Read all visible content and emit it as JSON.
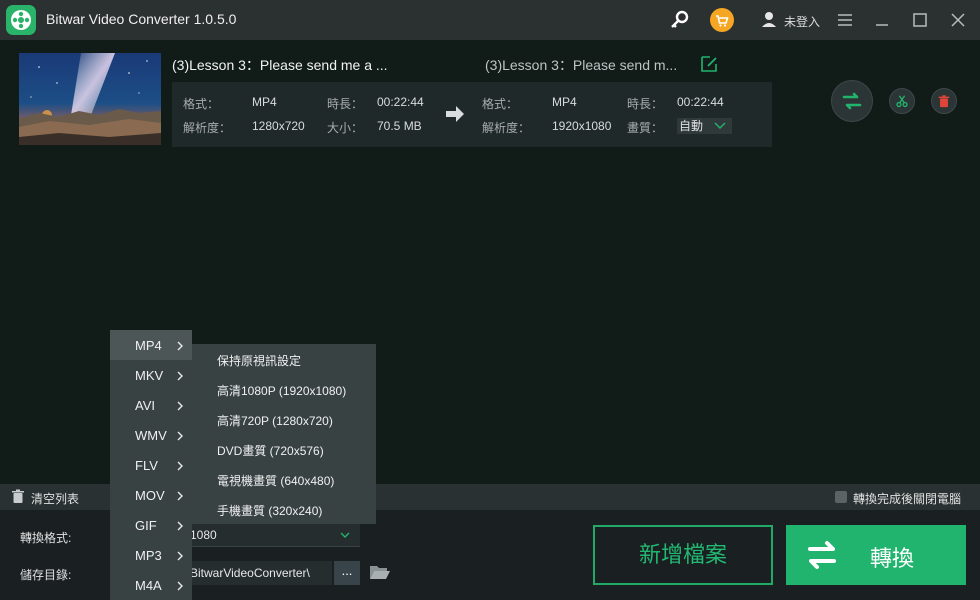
{
  "app": {
    "title": "Bitwar Video Converter  1.0.5.0",
    "login_label": "未登入"
  },
  "file": {
    "source_name": "(3)Lesson 3：Please send me a ...",
    "target_name": "(3)Lesson 3：Please send m...",
    "source": {
      "format_label": "格式：",
      "format": "MP4",
      "duration_label": "時長：",
      "duration": "00:22:44",
      "resolution_label": "解析度：",
      "resolution": "1280x720",
      "size_label": "大小：",
      "size": "70.5 MB"
    },
    "target": {
      "format_label": "格式：",
      "format": "MP4",
      "duration_label": "時長：",
      "duration": "00:22:44",
      "resolution_label": "解析度：",
      "resolution": "1920x1080",
      "quality_label": "畫質：",
      "quality": "自動"
    }
  },
  "listbar": {
    "clear_label": "清空列表",
    "shutdown_label": "轉換完成後關閉電腦"
  },
  "bottom": {
    "format_label": "轉換格式:",
    "format_value": "1080",
    "directory_label": "儲存目錄:",
    "directory_value": "BitwarVideoConverter\\",
    "browse_label": "...",
    "add_label": "新增檔案",
    "convert_label": "轉換"
  },
  "format_menu": [
    "MP4",
    "MKV",
    "AVI",
    "WMV",
    "FLV",
    "MOV",
    "GIF",
    "MP3",
    "M4A"
  ],
  "resolution_menu": [
    "保持原視訊設定",
    "高清1080P (1920x1080)",
    "高清720P (1280x720)",
    "DVD畫質 (720x576)",
    "電視機畫質 (640x480)",
    "手機畫質 (320x240)"
  ],
  "colors": {
    "accent": "#21b46e",
    "cart": "#f5a623",
    "delete": "#e0453a"
  }
}
